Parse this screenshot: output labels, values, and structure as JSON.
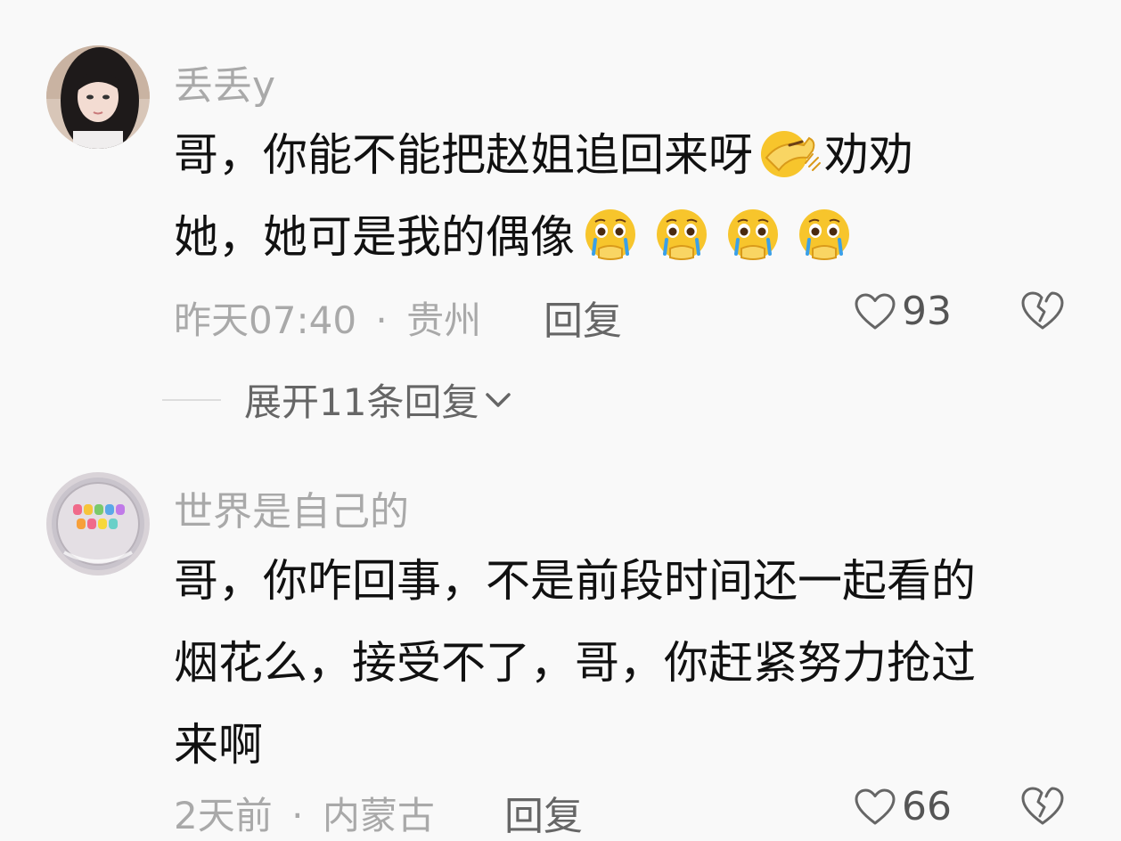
{
  "comments": [
    {
      "username": "丢丢y",
      "text_line1": "哥，你能不能把赵姐追回来呀",
      "text_line1_after": "劝劝",
      "text_line2": "她，她可是我的偶像",
      "time": "昨天07:40",
      "sep": "·",
      "location": "贵州",
      "reply_label": "回复",
      "likes": "93",
      "emojis": [
        "facepalm-emoji",
        "pleading-tears-emoji"
      ]
    },
    {
      "username": "世界是自己的",
      "text_line1": "哥，你咋回事，不是前段时间还一起看的",
      "text_line2": "烟花么，接受不了，哥，你赶紧努力抢过",
      "text_line3": "来啊",
      "time": "2天前",
      "sep": "·",
      "location": "内蒙古",
      "reply_label": "回复",
      "likes": "66"
    }
  ],
  "expand_replies": {
    "label": "展开11条回复"
  }
}
